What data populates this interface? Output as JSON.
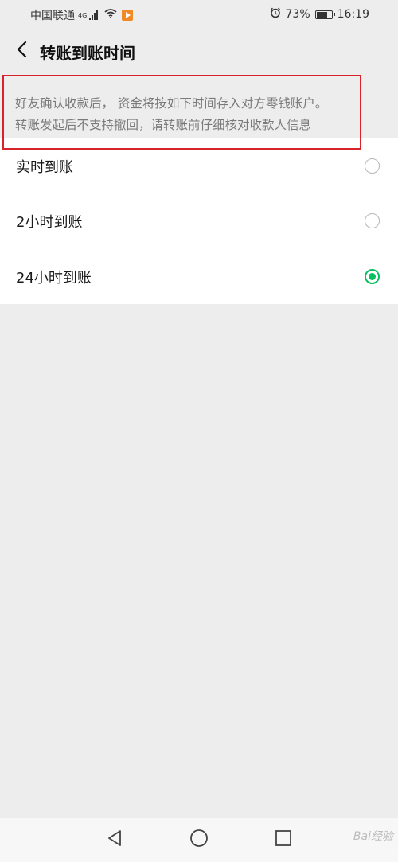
{
  "status_bar": {
    "carrier": "中国联通",
    "network_type": "4G",
    "battery_percent": "73%",
    "time": "16:19",
    "icons": [
      "signal-icon",
      "wifi-icon",
      "app-notification-icon",
      "alarm-icon",
      "battery-icon"
    ]
  },
  "header": {
    "title": "转账到账时间",
    "back_icon": "back-chevron-icon"
  },
  "notice": {
    "line1": "好友确认收款后， 资金将按如下时间存入对方零钱账户。",
    "line2": "转账发起后不支持撤回，请转账前仔细核对收款人信息",
    "highlight_color": "#d8232a"
  },
  "options": [
    {
      "label": "实时到账",
      "selected": false
    },
    {
      "label": "2小时到账",
      "selected": false
    },
    {
      "label": "24小时到账",
      "selected": true
    }
  ],
  "accent_color": "#07c160",
  "system_nav": {
    "buttons": [
      "back-triangle-icon",
      "home-circle-icon",
      "recents-square-icon"
    ]
  },
  "watermark": "Bai经验"
}
